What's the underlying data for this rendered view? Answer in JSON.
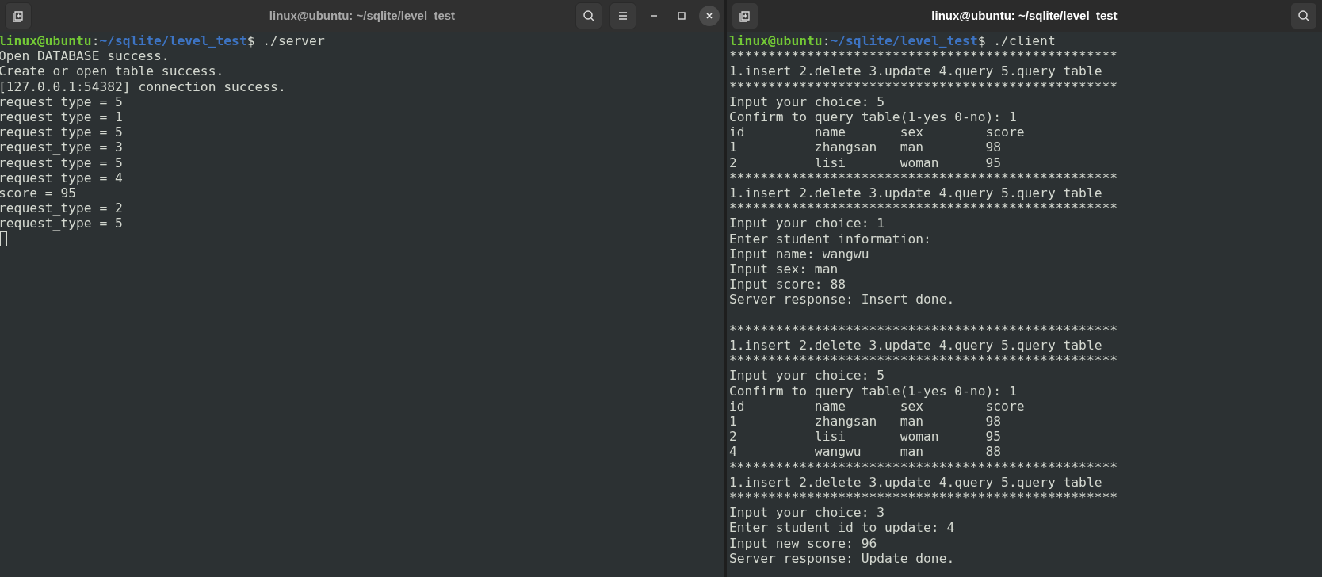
{
  "windows": [
    {
      "title": "linux@ubuntu: ~/sqlite/level_test",
      "active": false,
      "buttons": [
        {
          "kind": "new-tab"
        },
        {
          "kind": "search"
        },
        {
          "kind": "menu"
        },
        {
          "kind": "minimize"
        },
        {
          "kind": "maximize"
        },
        {
          "kind": "close"
        }
      ],
      "lines": [
        {
          "kind": "prompt",
          "user": "linux@ubuntu",
          "separator": ":",
          "path": "~/sqlite/level_test",
          "command": "$ ./server"
        },
        {
          "kind": "output",
          "text": "Open DATABASE success."
        },
        {
          "kind": "output",
          "text": "Create or open table success."
        },
        {
          "kind": "output",
          "text": "[127.0.0.1:54382] connection success."
        },
        {
          "kind": "output",
          "text": "request_type = 5"
        },
        {
          "kind": "output",
          "text": "request_type = 1"
        },
        {
          "kind": "output",
          "text": "request_type = 5"
        },
        {
          "kind": "output",
          "text": "request_type = 3"
        },
        {
          "kind": "output",
          "text": "request_type = 5"
        },
        {
          "kind": "output",
          "text": "request_type = 4"
        },
        {
          "kind": "output",
          "text": "score = 95"
        },
        {
          "kind": "output",
          "text": "request_type = 2"
        },
        {
          "kind": "output",
          "text": "request_type = 5"
        },
        {
          "kind": "cursor"
        }
      ]
    },
    {
      "title": "linux@ubuntu: ~/sqlite/level_test",
      "active": true,
      "buttons": [
        {
          "kind": "new-tab"
        },
        {
          "kind": "search"
        }
      ],
      "lines": [
        {
          "kind": "prompt",
          "user": "linux@ubuntu",
          "separator": ":",
          "path": "~/sqlite/level_test",
          "command": "$ ./client"
        },
        {
          "kind": "output",
          "text": "**************************************************"
        },
        {
          "kind": "output",
          "text": "1.insert 2.delete 3.update 4.query 5.query table"
        },
        {
          "kind": "output",
          "text": "**************************************************"
        },
        {
          "kind": "output",
          "text": "Input your choice: 5"
        },
        {
          "kind": "output",
          "text": "Confirm to query table(1-yes 0-no): 1"
        },
        {
          "kind": "output",
          "text": "id         name       sex        score"
        },
        {
          "kind": "output",
          "text": "1          zhangsan   man        98"
        },
        {
          "kind": "output",
          "text": "2          lisi       woman      95"
        },
        {
          "kind": "output",
          "text": "**************************************************"
        },
        {
          "kind": "output",
          "text": "1.insert 2.delete 3.update 4.query 5.query table"
        },
        {
          "kind": "output",
          "text": "**************************************************"
        },
        {
          "kind": "output",
          "text": "Input your choice: 1"
        },
        {
          "kind": "output",
          "text": "Enter student information:"
        },
        {
          "kind": "output",
          "text": "Input name: wangwu"
        },
        {
          "kind": "output",
          "text": "Input sex: man"
        },
        {
          "kind": "output",
          "text": "Input score: 88"
        },
        {
          "kind": "output",
          "text": "Server response: Insert done."
        },
        {
          "kind": "blank"
        },
        {
          "kind": "output",
          "text": "**************************************************"
        },
        {
          "kind": "output",
          "text": "1.insert 2.delete 3.update 4.query 5.query table"
        },
        {
          "kind": "output",
          "text": "**************************************************"
        },
        {
          "kind": "output",
          "text": "Input your choice: 5"
        },
        {
          "kind": "output",
          "text": "Confirm to query table(1-yes 0-no): 1"
        },
        {
          "kind": "output",
          "text": "id         name       sex        score"
        },
        {
          "kind": "output",
          "text": "1          zhangsan   man        98"
        },
        {
          "kind": "output",
          "text": "2          lisi       woman      95"
        },
        {
          "kind": "output",
          "text": "4          wangwu     man        88"
        },
        {
          "kind": "output",
          "text": "**************************************************"
        },
        {
          "kind": "output",
          "text": "1.insert 2.delete 3.update 4.query 5.query table"
        },
        {
          "kind": "output",
          "text": "**************************************************"
        },
        {
          "kind": "output",
          "text": "Input your choice: 3"
        },
        {
          "kind": "output",
          "text": "Enter student id to update: 4"
        },
        {
          "kind": "output",
          "text": "Input new score: 96"
        },
        {
          "kind": "output",
          "text": "Server response: Update done."
        }
      ]
    }
  ]
}
